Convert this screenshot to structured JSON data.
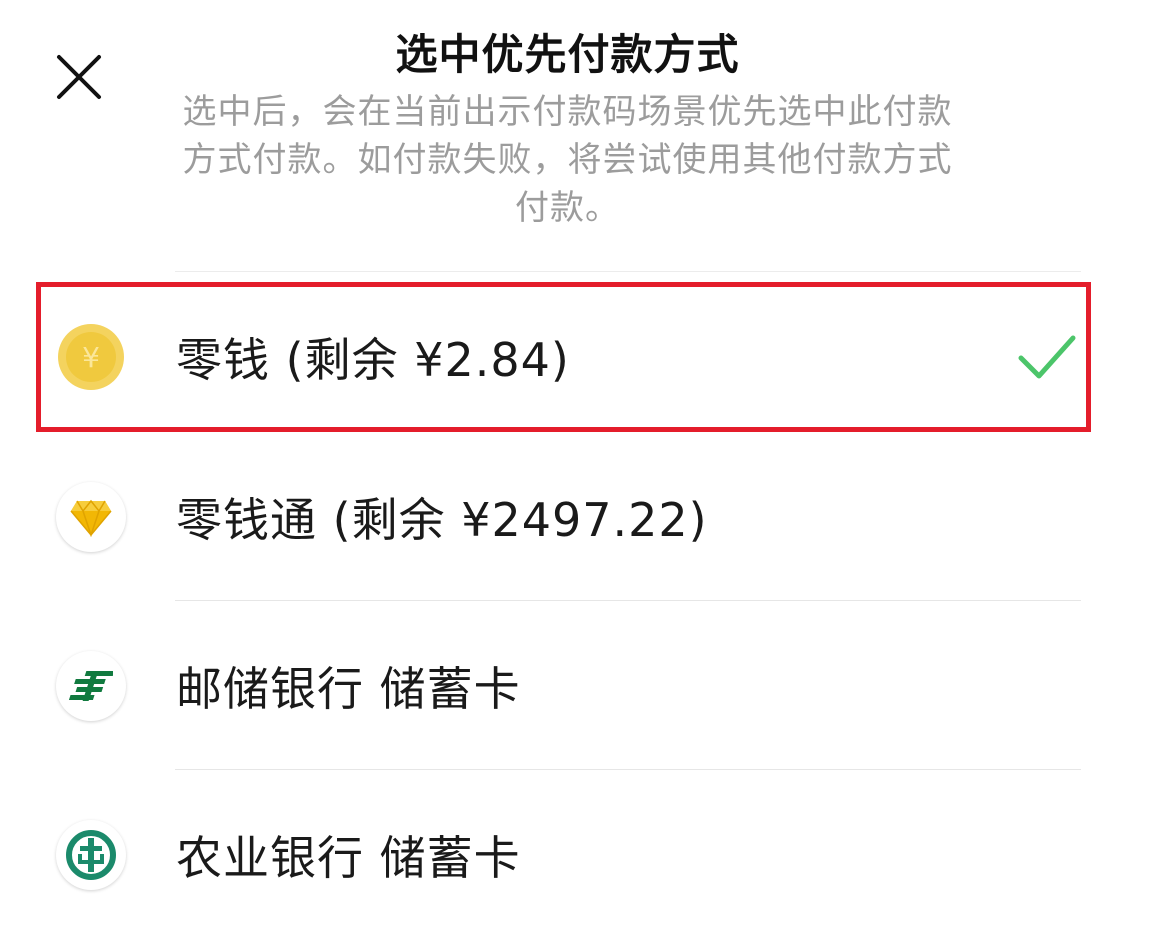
{
  "header": {
    "title": "选中优先付款方式",
    "description": "选中后，会在当前出示付款码场景优先选中此付款方式付款。如付款失败，将尝试使用其他付款方式付款。"
  },
  "payment_methods": [
    {
      "label": "零钱 (剩余 ¥2.84)",
      "icon": "coin-yuan-icon",
      "selected": true
    },
    {
      "label": "零钱通 (剩余 ¥2497.22)",
      "icon": "diamond-icon",
      "selected": false
    },
    {
      "label": "邮储银行 储蓄卡",
      "icon": "psbc-logo-icon",
      "selected": false
    },
    {
      "label": "农业银行 储蓄卡",
      "icon": "abc-logo-icon",
      "selected": false
    }
  ],
  "colors": {
    "highlight_border": "#e41d2b",
    "check_green": "#4cc56a",
    "coin_yellow": "#f4d35e",
    "psbc_green": "#117a3f",
    "abc_green": "#1b8a6b"
  }
}
